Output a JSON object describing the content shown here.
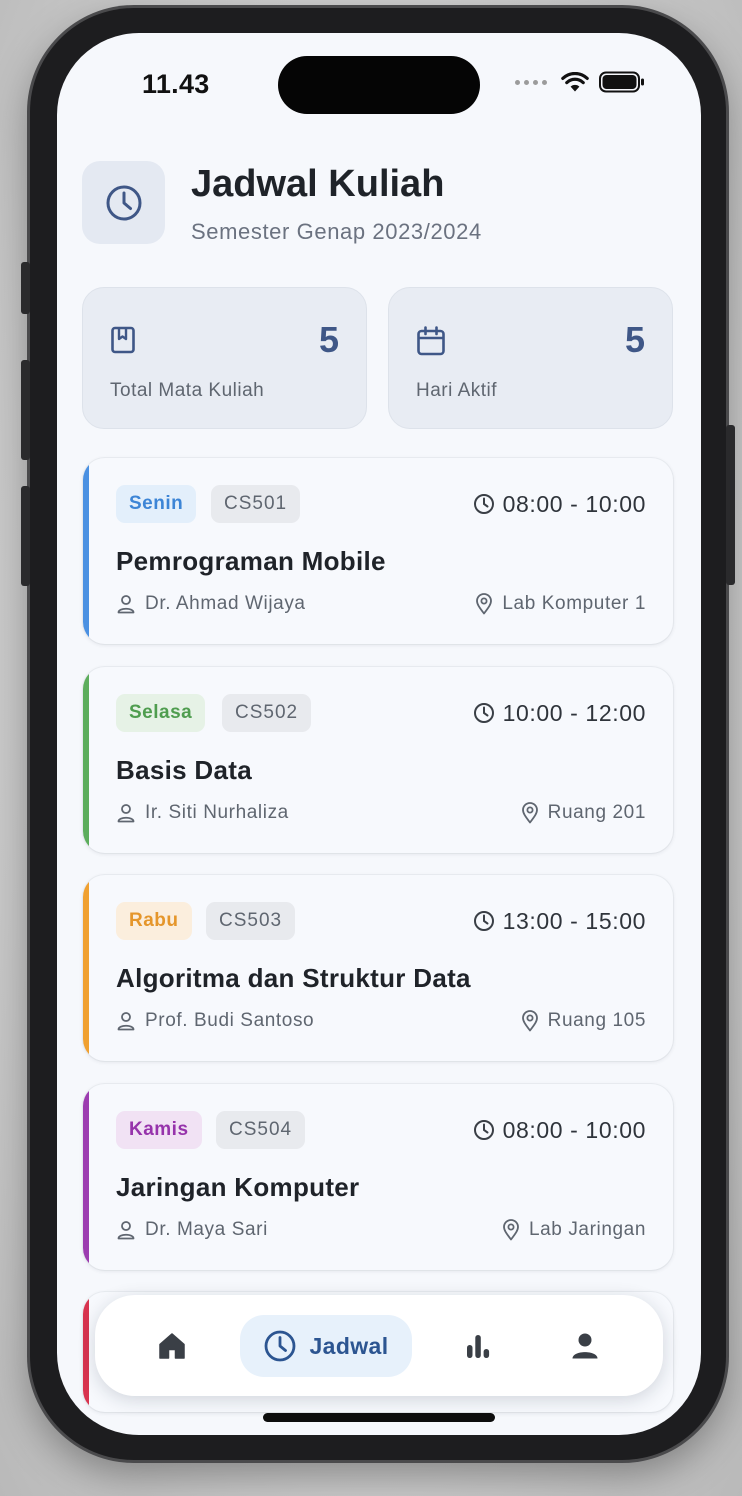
{
  "status_bar": {
    "time": "11.43"
  },
  "header": {
    "icon": "clock-icon",
    "title": "Jadwal Kuliah",
    "subtitle": "Semester Genap 2023/2024"
  },
  "stats": [
    {
      "icon": "book-icon",
      "value": "5",
      "label": "Total Mata Kuliah"
    },
    {
      "icon": "calendar-icon",
      "value": "5",
      "label": "Hari Aktif"
    }
  ],
  "courses": [
    {
      "day": "Senin",
      "code": "CS501",
      "time": "08:00 - 10:00",
      "title": "Pemrograman Mobile",
      "lecturer": "Dr. Ahmad Wijaya",
      "room": "Lab Komputer 1",
      "accent": "#4a90e2",
      "chip_bg": "#e3effb",
      "chip_text": "#3d85d6"
    },
    {
      "day": "Selasa",
      "code": "CS502",
      "time": "10:00 - 12:00",
      "title": "Basis Data",
      "lecturer": "Ir. Siti Nurhaliza",
      "room": "Ruang 201",
      "accent": "#5cad5c",
      "chip_bg": "#e6f2e6",
      "chip_text": "#4f9d4f"
    },
    {
      "day": "Rabu",
      "code": "CS503",
      "time": "13:00 - 15:00",
      "title": "Algoritma dan Struktur Data",
      "lecturer": "Prof. Budi Santoso",
      "room": "Ruang 105",
      "accent": "#f0a030",
      "chip_bg": "#fbeedd",
      "chip_text": "#e5962b"
    },
    {
      "day": "Kamis",
      "code": "CS504",
      "time": "08:00 - 10:00",
      "title": "Jaringan Komputer",
      "lecturer": "Dr. Maya Sari",
      "room": "Lab Jaringan",
      "accent": "#9c3cb0",
      "chip_bg": "#f1e2f4",
      "chip_text": "#9633ab"
    }
  ],
  "partial_card_accent": "#d8344f",
  "bottom_nav": {
    "items": [
      {
        "icon": "home-icon"
      },
      {
        "icon": "clock-icon",
        "label": "Jadwal",
        "active": true
      },
      {
        "icon": "bar-chart-icon"
      },
      {
        "icon": "person-icon"
      }
    ]
  }
}
